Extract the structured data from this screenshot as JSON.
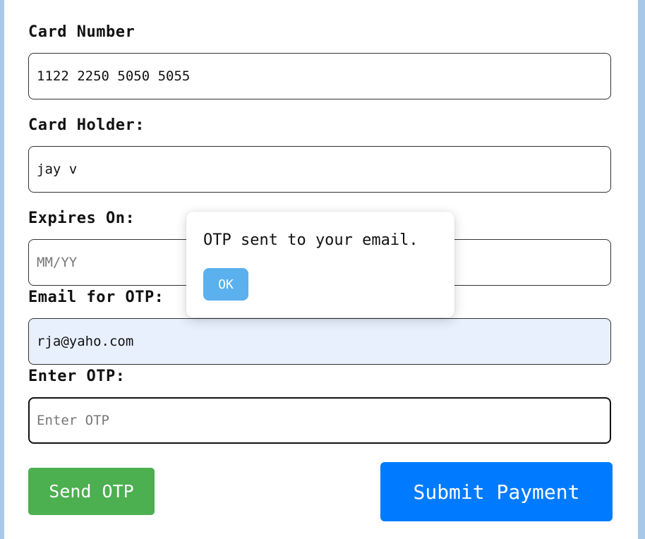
{
  "form": {
    "card_number": {
      "label": "Card Number",
      "value": "1122 2250 5050 5055",
      "placeholder": ""
    },
    "card_holder": {
      "label": "Card Holder:",
      "value": "jay v",
      "placeholder": ""
    },
    "expires_on": {
      "label": "Expires On:",
      "value": "",
      "placeholder": "MM/YY"
    },
    "email": {
      "label": "Email for OTP:",
      "value": "rja@yaho.com",
      "placeholder": ""
    },
    "otp": {
      "label": "Enter OTP:",
      "value": "",
      "placeholder": "Enter OTP"
    },
    "send_otp_label": "Send OTP",
    "submit_label": "Submit Payment"
  },
  "dialog": {
    "message": "OTP sent to your email.",
    "ok_label": "OK"
  },
  "colors": {
    "page_background": "#a8c8ea",
    "send_button": "#4caf50",
    "submit_button": "#007bff",
    "ok_button": "#5bb0ee",
    "autofill_field": "#e8f0fe"
  }
}
